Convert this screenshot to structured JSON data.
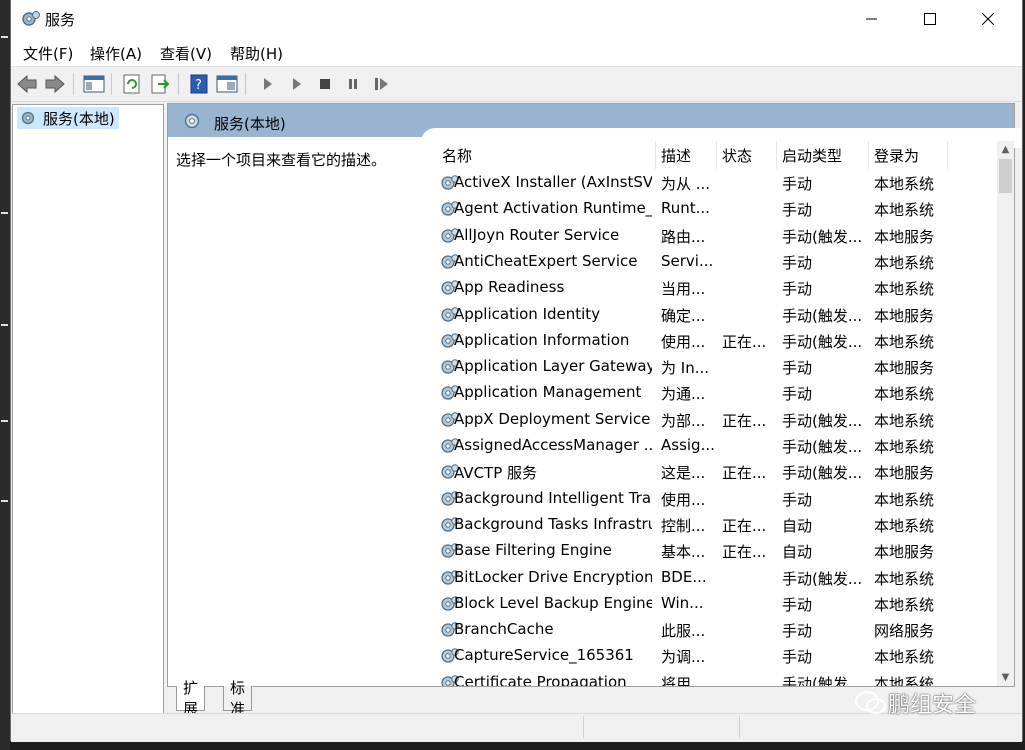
{
  "window": {
    "title": "服务",
    "minimize_icon": "minimize-icon",
    "maximize_icon": "maximize-icon",
    "close_icon": "close-icon"
  },
  "menu": [
    "文件(F)",
    "操作(A)",
    "查看(V)",
    "帮助(H)"
  ],
  "toolbar": [
    "back-icon",
    "forward-icon",
    "show-hide-console-tree-icon",
    "refresh-icon",
    "export-list-icon",
    "help-icon",
    "properties-icon",
    "start-service-icon",
    "start-service-alt-icon",
    "stop-service-icon",
    "pause-service-icon",
    "restart-service-icon"
  ],
  "tree": {
    "item": "服务(本地)"
  },
  "panel": {
    "header": "服务(本地)",
    "description": "选择一个项目来查看它的描述。"
  },
  "columns": {
    "name": "名称",
    "desc": "描述",
    "status": "状态",
    "startup": "启动类型",
    "logon": "登录为"
  },
  "services": [
    {
      "name": "ActiveX Installer (AxInstSV)",
      "desc": "为从 ...",
      "status": "",
      "startup": "手动",
      "logon": "本地系统"
    },
    {
      "name": "Agent Activation Runtime_...",
      "desc": "Runt...",
      "status": "",
      "startup": "手动",
      "logon": "本地系统"
    },
    {
      "name": "AllJoyn Router Service",
      "desc": "路由...",
      "status": "",
      "startup": "手动(触发...",
      "logon": "本地服务"
    },
    {
      "name": "AntiCheatExpert Service",
      "desc": "Servi...",
      "status": "",
      "startup": "手动",
      "logon": "本地系统"
    },
    {
      "name": "App Readiness",
      "desc": "当用...",
      "status": "",
      "startup": "手动",
      "logon": "本地系统"
    },
    {
      "name": "Application Identity",
      "desc": "确定...",
      "status": "",
      "startup": "手动(触发...",
      "logon": "本地服务"
    },
    {
      "name": "Application Information",
      "desc": "使用...",
      "status": "正在...",
      "startup": "手动(触发...",
      "logon": "本地系统"
    },
    {
      "name": "Application Layer Gateway ...",
      "desc": "为 In...",
      "status": "",
      "startup": "手动",
      "logon": "本地服务"
    },
    {
      "name": "Application Management",
      "desc": "为通...",
      "status": "",
      "startup": "手动",
      "logon": "本地系统"
    },
    {
      "name": "AppX Deployment Service ...",
      "desc": "为部...",
      "status": "正在...",
      "startup": "手动(触发...",
      "logon": "本地系统"
    },
    {
      "name": "AssignedAccessManager ...",
      "desc": "Assig...",
      "status": "",
      "startup": "手动(触发...",
      "logon": "本地系统"
    },
    {
      "name": "AVCTP 服务",
      "desc": "这是...",
      "status": "正在...",
      "startup": "手动(触发...",
      "logon": "本地服务"
    },
    {
      "name": "Background Intelligent Tra...",
      "desc": "使用...",
      "status": "",
      "startup": "手动",
      "logon": "本地系统"
    },
    {
      "name": "Background Tasks Infrastru...",
      "desc": "控制...",
      "status": "正在...",
      "startup": "自动",
      "logon": "本地系统"
    },
    {
      "name": "Base Filtering Engine",
      "desc": "基本...",
      "status": "正在...",
      "startup": "自动",
      "logon": "本地服务"
    },
    {
      "name": "BitLocker Drive Encryption ...",
      "desc": "BDE...",
      "status": "",
      "startup": "手动(触发...",
      "logon": "本地系统"
    },
    {
      "name": "Block Level Backup Engine ...",
      "desc": "Win...",
      "status": "",
      "startup": "手动",
      "logon": "本地系统"
    },
    {
      "name": "BranchCache",
      "desc": "此服...",
      "status": "",
      "startup": "手动",
      "logon": "网络服务"
    },
    {
      "name": "CaptureService_165361",
      "desc": "为调...",
      "status": "",
      "startup": "手动",
      "logon": "本地系统"
    },
    {
      "name": "Certificate Propagation",
      "desc": "将用...",
      "status": "",
      "startup": "手动(触发...",
      "logon": "本地系统"
    }
  ],
  "tabs": [
    "扩展",
    "标准"
  ],
  "watermark": "鹏组安全"
}
